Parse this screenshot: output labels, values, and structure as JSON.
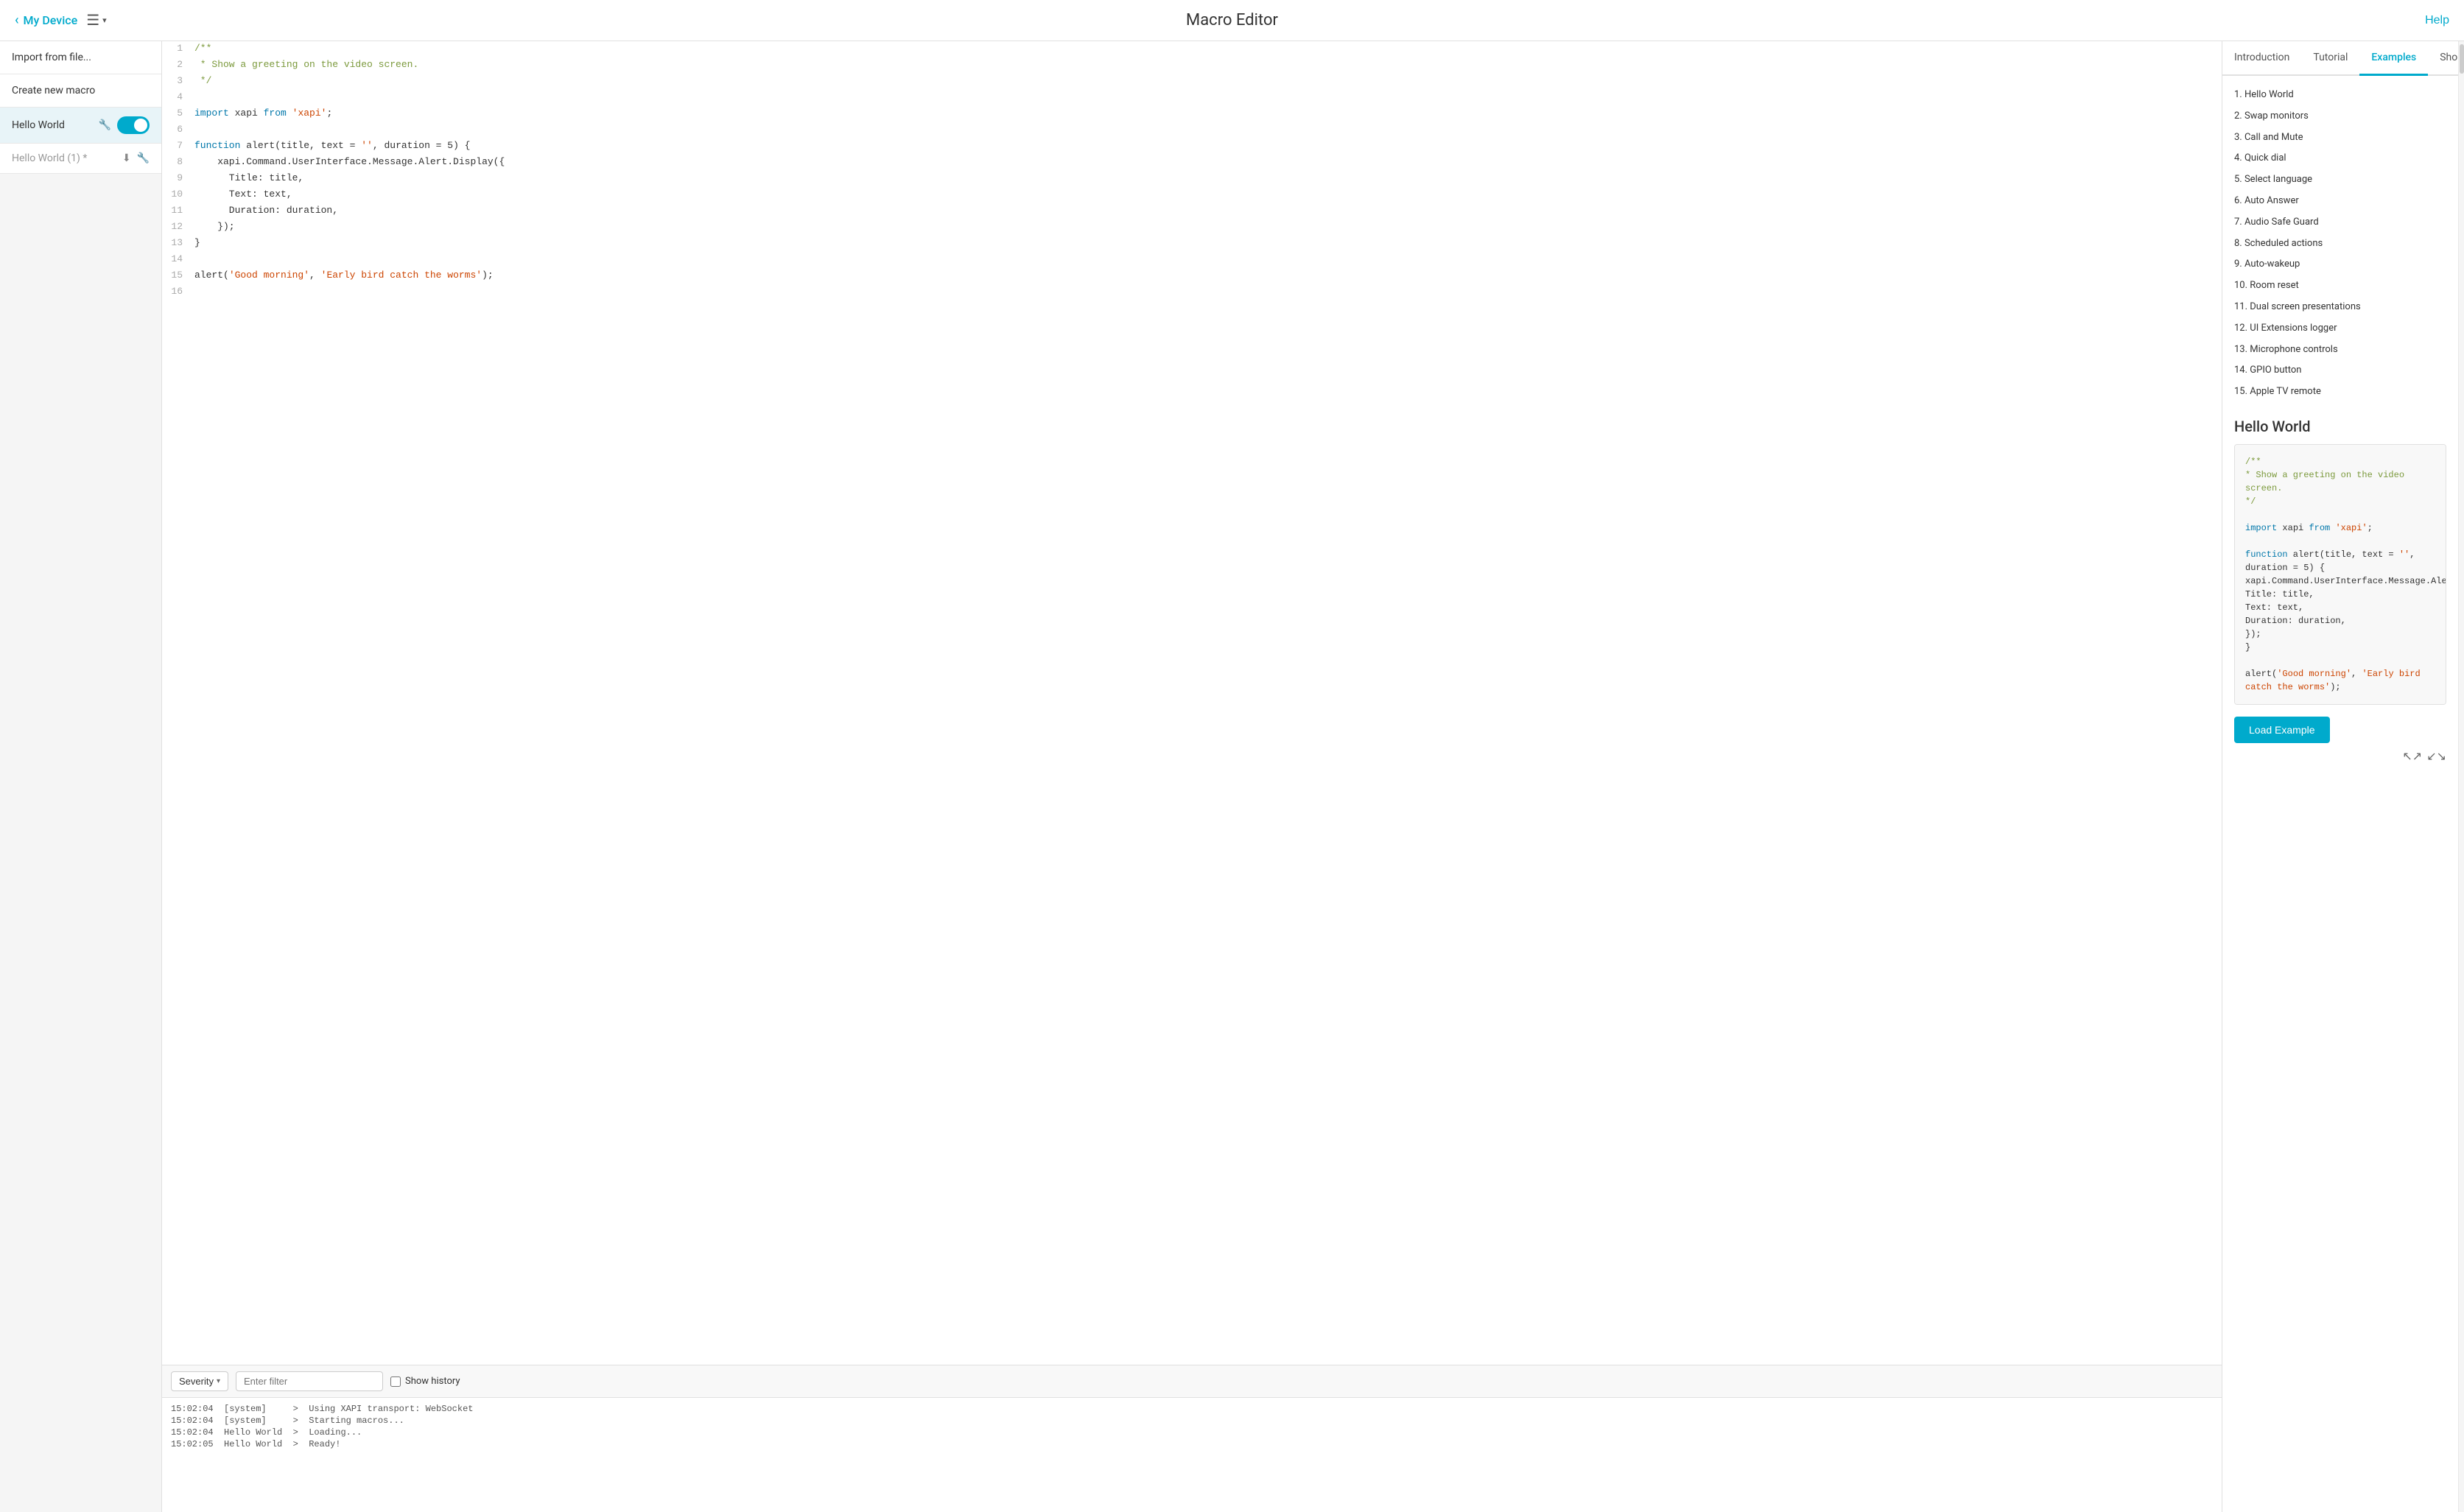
{
  "nav": {
    "back_label": "My Device",
    "title": "Macro Editor",
    "help_label": "Help",
    "menu_icon": "☰"
  },
  "sidebar": {
    "import_label": "Import from file...",
    "create_label": "Create new macro",
    "macros": [
      {
        "name": "Hello World",
        "active": true,
        "toggle": true,
        "icons": [
          "wrench",
          "download"
        ]
      },
      {
        "name": "Hello World (1) *",
        "active": false,
        "toggle": false,
        "icons": [
          "download",
          "wrench"
        ]
      }
    ]
  },
  "editor": {
    "lines": [
      {
        "num": 1,
        "content": "/**",
        "type": "comment"
      },
      {
        "num": 2,
        "content": " * Show a greeting on the video screen.",
        "type": "comment"
      },
      {
        "num": 3,
        "content": " */",
        "type": "comment"
      },
      {
        "num": 4,
        "content": "",
        "type": "plain"
      },
      {
        "num": 5,
        "content": "import xapi from 'xapi';",
        "type": "import"
      },
      {
        "num": 6,
        "content": "",
        "type": "plain"
      },
      {
        "num": 7,
        "content": "function alert(title, text = '', duration = 5) {",
        "type": "function"
      },
      {
        "num": 8,
        "content": "  xapi.Command.UserInterface.Message.Alert.Display({",
        "type": "plain"
      },
      {
        "num": 9,
        "content": "    Title: title,",
        "type": "plain"
      },
      {
        "num": 10,
        "content": "    Text: text,",
        "type": "plain"
      },
      {
        "num": 11,
        "content": "    Duration: duration,",
        "type": "plain"
      },
      {
        "num": 12,
        "content": "  });",
        "type": "plain"
      },
      {
        "num": 13,
        "content": "}",
        "type": "plain"
      },
      {
        "num": 14,
        "content": "",
        "type": "plain"
      },
      {
        "num": 15,
        "content": "alert('Good morning', 'Early bird catch the worms');",
        "type": "call"
      },
      {
        "num": 16,
        "content": "",
        "type": "plain"
      }
    ]
  },
  "log": {
    "severity_label": "Severity",
    "filter_placeholder": "Enter filter",
    "show_history_label": "Show history",
    "entries": [
      "15:02:04  [system]     >  Using XAPI transport: WebSocket",
      "15:02:04  [system]     >  Starting macros...",
      "15:02:04  Hello World  >  Loading...",
      "15:02:05  Hello World  >  Ready!"
    ]
  },
  "right_panel": {
    "tabs": [
      {
        "id": "introduction",
        "label": "Introduction"
      },
      {
        "id": "tutorial",
        "label": "Tutorial"
      },
      {
        "id": "examples",
        "label": "Examples"
      },
      {
        "id": "shortcuts",
        "label": "Shortcuts"
      }
    ],
    "active_tab": "examples",
    "examples_list": [
      "1.  Hello World",
      "2.  Swap monitors",
      "3.  Call and Mute",
      "4.  Quick dial",
      "5.  Select language",
      "6.  Auto Answer",
      "7.  Audio Safe Guard",
      "8.  Scheduled actions",
      "9.  Auto-wakeup",
      "10. Room reset",
      "11. Dual screen presentations",
      "12. UI Extensions logger",
      "13. Microphone controls",
      "14. GPIO button",
      "15. Apple TV remote"
    ],
    "example_section": {
      "title": "Hello World",
      "code_lines": [
        {
          "text": "/**",
          "type": "comment"
        },
        {
          "text": " * Show a greeting on the video screen.",
          "type": "comment"
        },
        {
          "text": " */",
          "type": "comment"
        },
        {
          "text": "",
          "type": "plain"
        },
        {
          "text": "import xapi from 'xapi';",
          "type": "import"
        },
        {
          "text": "",
          "type": "plain"
        },
        {
          "text": "function alert(title, text = '', duration = 5) {",
          "type": "function"
        },
        {
          "text": "  xapi.Command.UserInterface.Message.Alert.Display({",
          "type": "plain"
        },
        {
          "text": "    Title: title,",
          "type": "plain"
        },
        {
          "text": "    Text: text,",
          "type": "plain"
        },
        {
          "text": "    Duration: duration,",
          "type": "plain"
        },
        {
          "text": "  });",
          "type": "plain"
        },
        {
          "text": "}",
          "type": "plain"
        },
        {
          "text": "",
          "type": "plain"
        },
        {
          "text": "alert('Good morning', 'Early bird catch the worms');",
          "type": "call"
        }
      ],
      "load_button_label": "Load Example"
    }
  },
  "colors": {
    "accent": "#00aacc",
    "comment": "#7c9a3d",
    "keyword": "#0077aa",
    "string": "#cc4400"
  }
}
